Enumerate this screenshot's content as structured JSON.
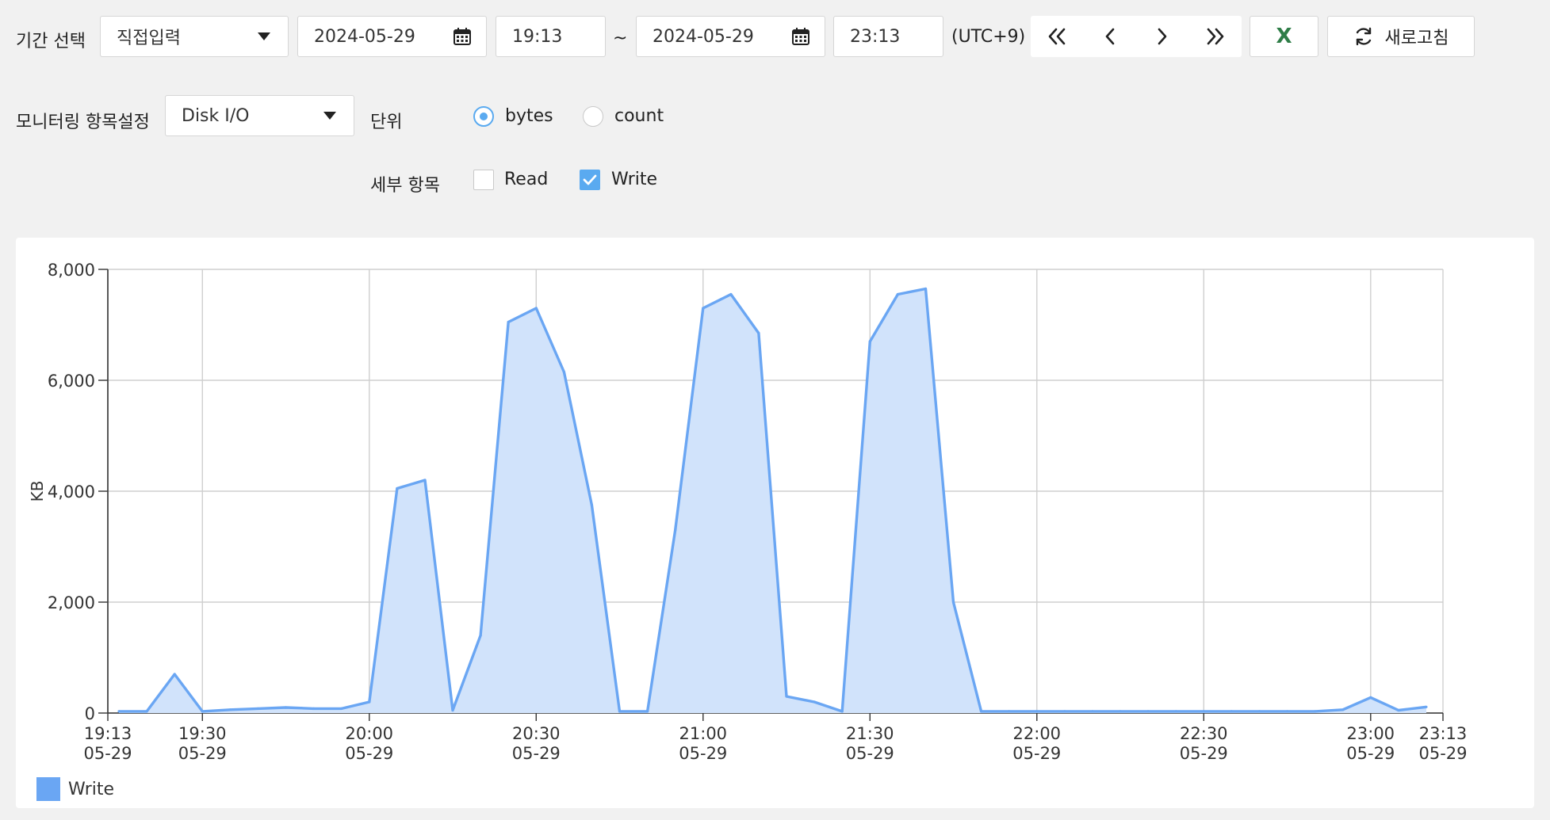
{
  "period": {
    "label": "기간 선택",
    "mode": "직접입력",
    "start_date": "2024-05-29",
    "start_time": "19:13",
    "separator": "~",
    "end_date": "2024-05-29",
    "end_time": "23:13",
    "timezone": "(UTC+9)"
  },
  "toolbar": {
    "excel_label": "X",
    "refresh_label": "새로고침"
  },
  "monitoring": {
    "label": "모니터링 항목설정",
    "item": "Disk I/O",
    "unit_label": "단위",
    "unit_options": [
      {
        "label": "bytes",
        "selected": true
      },
      {
        "label": "count",
        "selected": false
      }
    ],
    "detail_label": "세부 항목",
    "detail_options": [
      {
        "label": "Read",
        "checked": false
      },
      {
        "label": "Write",
        "checked": true
      }
    ]
  },
  "colors": {
    "accent": "#5aaaf0",
    "series_line": "#6aa6f3",
    "series_fill": "#d1e3fb",
    "excel_green": "#2e7d47"
  },
  "chart_data": {
    "type": "area",
    "ylabel": "KB",
    "ylim": [
      0,
      8000
    ],
    "y_ticks": [
      "0",
      "2,000",
      "4,000",
      "6,000",
      "8,000"
    ],
    "x_ticks": [
      {
        "time": "19:13",
        "date": "05-29"
      },
      {
        "time": "19:30",
        "date": "05-29"
      },
      {
        "time": "20:00",
        "date": "05-29"
      },
      {
        "time": "20:30",
        "date": "05-29"
      },
      {
        "time": "21:00",
        "date": "05-29"
      },
      {
        "time": "21:30",
        "date": "05-29"
      },
      {
        "time": "22:00",
        "date": "05-29"
      },
      {
        "time": "22:30",
        "date": "05-29"
      },
      {
        "time": "23:00",
        "date": "05-29"
      },
      {
        "time": "23:13",
        "date": "05-29"
      }
    ],
    "grid": true,
    "legend": "bottom-left",
    "series": [
      {
        "name": "Write",
        "points": [
          [
            "19:15",
            30
          ],
          [
            "19:20",
            30
          ],
          [
            "19:25",
            700
          ],
          [
            "19:30",
            30
          ],
          [
            "19:35",
            60
          ],
          [
            "19:40",
            80
          ],
          [
            "19:45",
            100
          ],
          [
            "19:50",
            80
          ],
          [
            "19:55",
            80
          ],
          [
            "20:00",
            200
          ],
          [
            "20:05",
            4050
          ],
          [
            "20:10",
            4200
          ],
          [
            "20:15",
            50
          ],
          [
            "20:20",
            1400
          ],
          [
            "20:25",
            7050
          ],
          [
            "20:30",
            7300
          ],
          [
            "20:35",
            6150
          ],
          [
            "20:40",
            3750
          ],
          [
            "20:45",
            30
          ],
          [
            "20:50",
            30
          ],
          [
            "20:55",
            3300
          ],
          [
            "21:00",
            7300
          ],
          [
            "21:05",
            7550
          ],
          [
            "21:10",
            6850
          ],
          [
            "21:15",
            300
          ],
          [
            "21:20",
            200
          ],
          [
            "21:25",
            30
          ],
          [
            "21:30",
            6700
          ],
          [
            "21:35",
            7550
          ],
          [
            "21:40",
            7650
          ],
          [
            "21:45",
            2000
          ],
          [
            "21:50",
            30
          ],
          [
            "21:55",
            30
          ],
          [
            "22:00",
            30
          ],
          [
            "22:05",
            30
          ],
          [
            "22:10",
            30
          ],
          [
            "22:15",
            30
          ],
          [
            "22:20",
            30
          ],
          [
            "22:25",
            30
          ],
          [
            "22:30",
            30
          ],
          [
            "22:35",
            30
          ],
          [
            "22:40",
            30
          ],
          [
            "22:45",
            30
          ],
          [
            "22:50",
            30
          ],
          [
            "22:55",
            60
          ],
          [
            "23:00",
            280
          ],
          [
            "23:05",
            50
          ],
          [
            "23:10",
            110
          ]
        ]
      }
    ]
  }
}
